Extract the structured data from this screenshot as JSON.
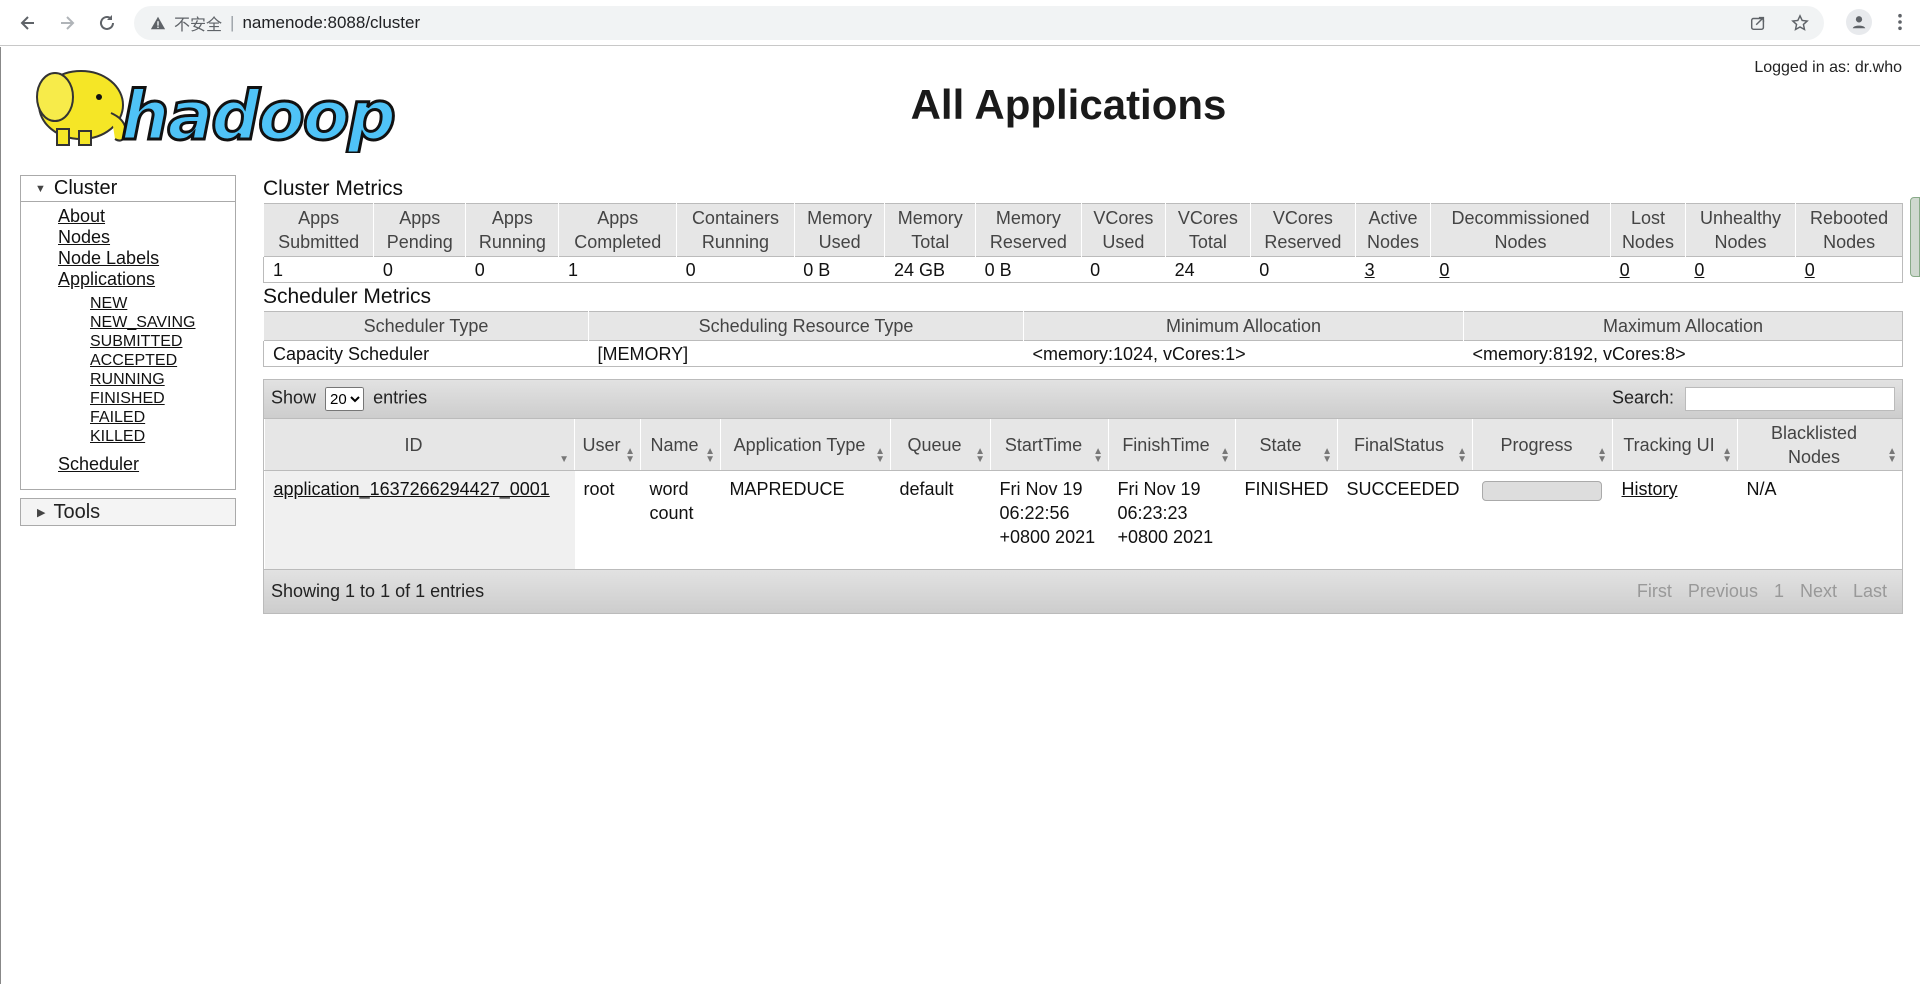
{
  "browser": {
    "security_label": "不安全",
    "separator": "|",
    "url": "namenode:8088/cluster"
  },
  "header": {
    "logged_in": "Logged in as: dr.who",
    "title": "All Applications",
    "logo_text": "hadoop"
  },
  "sidebar": {
    "cluster_label": "Cluster",
    "links": [
      "About",
      "Nodes",
      "Node Labels",
      "Applications"
    ],
    "app_states": [
      "NEW",
      "NEW_SAVING",
      "SUBMITTED",
      "ACCEPTED",
      "RUNNING",
      "FINISHED",
      "FAILED",
      "KILLED"
    ],
    "scheduler_label": "Scheduler",
    "tools_label": "Tools"
  },
  "cluster_metrics": {
    "title": "Cluster Metrics",
    "headers": [
      [
        "Apps",
        "Submitted"
      ],
      [
        "Apps",
        "Pending"
      ],
      [
        "Apps",
        "Running"
      ],
      [
        "Apps",
        "Completed"
      ],
      [
        "Containers",
        "Running"
      ],
      [
        "Memory",
        "Used"
      ],
      [
        "Memory",
        "Total"
      ],
      [
        "Memory",
        "Reserved"
      ],
      [
        "VCores",
        "Used"
      ],
      [
        "VCores",
        "Total"
      ],
      [
        "VCores",
        "Reserved"
      ],
      [
        "Active",
        "Nodes"
      ],
      [
        "Decommissioned",
        "Nodes"
      ],
      [
        "Lost",
        "Nodes"
      ],
      [
        "Unhealthy",
        "Nodes"
      ],
      [
        "Rebooted",
        "Nodes"
      ]
    ],
    "values": [
      "1",
      "0",
      "0",
      "1",
      "0",
      "0 B",
      "24 GB",
      "0 B",
      "0",
      "24",
      "0",
      "3",
      "0",
      "0",
      "0",
      "0"
    ]
  },
  "scheduler_metrics": {
    "title": "Scheduler Metrics",
    "headers": [
      "Scheduler Type",
      "Scheduling Resource Type",
      "Minimum Allocation",
      "Maximum Allocation"
    ],
    "values": [
      "Capacity Scheduler",
      "[MEMORY]",
      "<memory:1024, vCores:1>",
      "<memory:8192, vCores:8>"
    ]
  },
  "apps": {
    "show_label": "Show",
    "entries_label": "entries",
    "page_size": "20",
    "search_label": "Search:",
    "headers": [
      "ID",
      "User",
      "Name",
      "Application Type",
      "Queue",
      "StartTime",
      "FinishTime",
      "State",
      "FinalStatus",
      "Progress",
      "Tracking UI",
      "Blacklisted Nodes"
    ],
    "rows": [
      {
        "id": "application_1637266294427_0001",
        "user": "root",
        "name": "word count",
        "type": "MAPREDUCE",
        "queue": "default",
        "start": "Fri Nov 19 06:22:56 +0800 2021",
        "finish": "Fri Nov 19 06:23:23 +0800 2021",
        "state": "FINISHED",
        "final_status": "SUCCEEDED",
        "tracking": "History",
        "blacklisted": "N/A"
      }
    ],
    "footer": "Showing 1 to 1 of 1 entries",
    "pager": [
      "First",
      "Previous",
      "1",
      "Next",
      "Last"
    ]
  }
}
